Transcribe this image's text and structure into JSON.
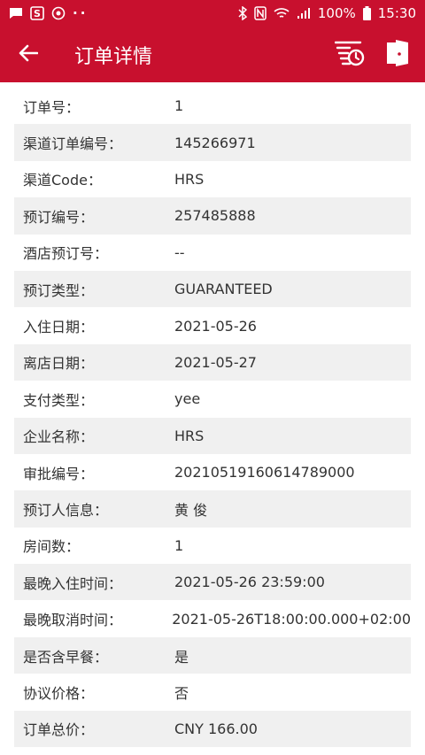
{
  "status_bar": {
    "battery": "100%",
    "time": "15:30",
    "notification_dots": "··"
  },
  "app_bar": {
    "title": "订单详情"
  },
  "details": [
    {
      "label": "订单号：",
      "value": "1"
    },
    {
      "label": "渠道订单编号：",
      "value": "145266971"
    },
    {
      "label": "渠道Code：",
      "value": "HRS"
    },
    {
      "label": "预订编号：",
      "value": "257485888"
    },
    {
      "label": "酒店预订号：",
      "value": "--"
    },
    {
      "label": "预订类型：",
      "value": "GUARANTEED"
    },
    {
      "label": "入住日期：",
      "value": "2021-05-26"
    },
    {
      "label": "离店日期：",
      "value": "2021-05-27"
    },
    {
      "label": "支付类型：",
      "value": "yee"
    },
    {
      "label": "企业名称：",
      "value": "HRS"
    },
    {
      "label": "审批编号：",
      "value": "20210519160614789000"
    },
    {
      "label": "预订人信息：",
      "value": "黄 俊"
    },
    {
      "label": "房间数：",
      "value": "1"
    },
    {
      "label": "最晚入住时间：",
      "value": "2021-05-26 23:59:00"
    },
    {
      "label": "最晚取消时间：",
      "value": "2021-05-26T18:00:00.000+02:00"
    },
    {
      "label": "是否含早餐：",
      "value": "是"
    },
    {
      "label": "协议价格：",
      "value": "否"
    },
    {
      "label": "订单总价：",
      "value": "CNY 166.00"
    }
  ],
  "colors": {
    "primary": "#c8102e",
    "row_alt": "#f0f0f0",
    "text": "#333333"
  },
  "icons": {
    "back": "arrow-left-icon",
    "history": "list-clock-icon",
    "exit": "door-exit-icon"
  }
}
